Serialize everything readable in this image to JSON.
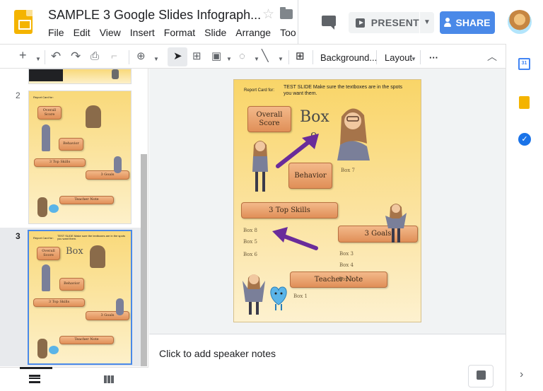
{
  "app": {
    "doc_title": "SAMPLE 3 Google Slides Infograph...",
    "menu": [
      "File",
      "Edit",
      "View",
      "Insert",
      "Format",
      "Slide",
      "Arrange",
      "Too"
    ]
  },
  "header": {
    "present_label": "PRESENT",
    "share_label": "SHARE"
  },
  "toolbar": {
    "background_label": "Background...",
    "layout_label": "Layout",
    "more_label": "···"
  },
  "filmstrip": {
    "slides": [
      {
        "number": "2"
      },
      {
        "number": "3"
      }
    ]
  },
  "slide": {
    "report_card_label": "Report Card for:",
    "test_note": "TEST SLIDE Make sure the textboxes are in the spots you want them.",
    "overall_score": "Overall Score",
    "box_big": "Box",
    "box_9": "9",
    "behavior": "Behavior",
    "box_7": "Box 7",
    "top_skills": "3 Top Skills",
    "goals": "3 Goals",
    "box_8": "Box 8",
    "box_5": "Box 5",
    "box_6": "Box 6",
    "box_3": "Box 3",
    "box_4": "Box 4",
    "teacher_note": "Teacher Note",
    "box_1": "Box 1",
    "box_2": "Box 2"
  },
  "thumbs": {
    "slide2_report": "Report Card for:",
    "slide2_overall": "Overall Score",
    "slide2_behavior": "Behavior",
    "slide2_skills": "3 Top Skills",
    "slide2_goals": "3 Goals",
    "slide2_teacher": "Teacher Note",
    "slide3_report": "Report Card for:",
    "slide3_test": "TEST SLIDE Make sure the textboxes are in the spots you want them.",
    "slide3_overall": "Overall Score",
    "slide3_box": "Box",
    "slide3_behavior": "Behavior",
    "slide3_skills": "3 Top Skills",
    "slide3_goals": "3 Goals",
    "slide3_teacher": "Teacher Note"
  },
  "notes": {
    "placeholder": "Click to add speaker notes"
  },
  "side_panel": {
    "calendar_day": "31"
  },
  "colors": {
    "accent": "#4a89e8",
    "slide_bg": "#f9d568",
    "tag": "#e9a06c",
    "arrow": "#6a2c9a"
  }
}
